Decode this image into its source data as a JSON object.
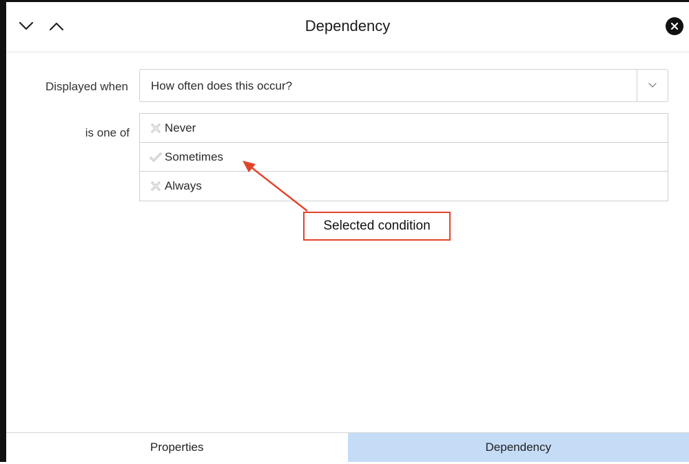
{
  "window": {
    "title": "Dependency"
  },
  "form": {
    "displayed_when_label": "Displayed when",
    "question_value": "How often does this occur?",
    "is_one_of_label": "is one of",
    "options": [
      {
        "label": "Never",
        "selected": false,
        "icon": "x-icon"
      },
      {
        "label": "Sometimes",
        "selected": true,
        "icon": "check-icon"
      },
      {
        "label": "Always",
        "selected": false,
        "icon": "x-icon"
      }
    ]
  },
  "annotation": {
    "text": "Selected condition",
    "color": "#e0452b"
  },
  "tabs": [
    {
      "label": "Properties",
      "active": false
    },
    {
      "label": "Dependency",
      "active": true
    }
  ],
  "colors": {
    "active_tab": "#c5dcf7",
    "border": "#cfcfcf"
  }
}
